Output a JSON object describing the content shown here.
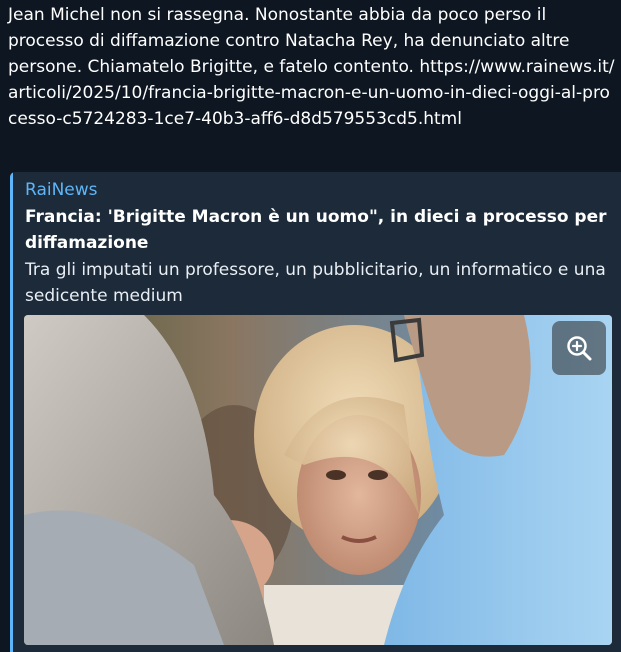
{
  "message": {
    "text": "Jean Michel non si rassegna. Nonostante abbia da poco perso il processo di diffamazione contro Natacha Rey, ha denunciato altre persone. Chiamatelo Brigitte, e fatelo contento.",
    "url": "https://www.rainews.it/articoli/2025/10/francia-brigitte-macron-e-un-uomo-in-dieci-oggi-al-processo-c5724283-1ce7-40b3-aff6-d8d579553cd5.html"
  },
  "link_preview": {
    "site_name": "RaiNews",
    "title": "Francia: 'Brigitte Macron è un uomo\", in dieci a processo per diffamazione",
    "description": "Tra gli imputati un professore, un pubblicitario, un informatico e una sedicente medium",
    "zoom_icon": "zoom-in-icon"
  },
  "colors": {
    "background": "#0e1621",
    "card": "#1c2a39",
    "accent": "#5eb5f7",
    "text": "#ffffff"
  }
}
